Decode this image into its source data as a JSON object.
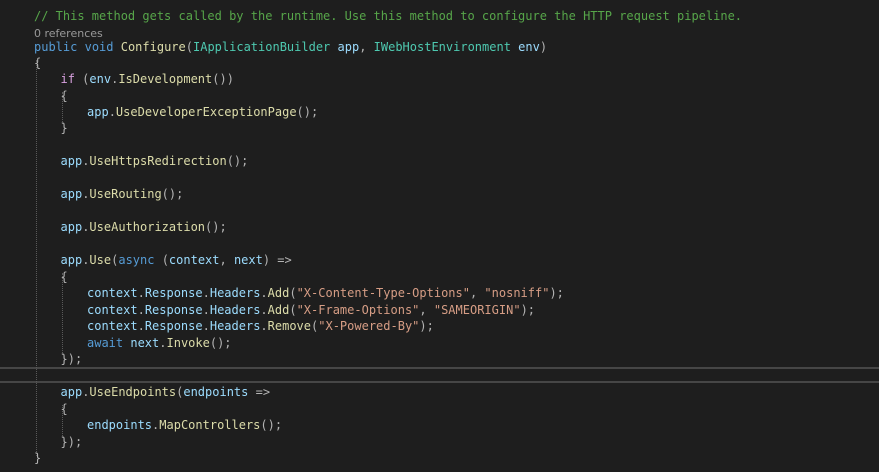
{
  "editor": {
    "codelens": "0 references",
    "lines": [
      [
        {
          "t": "com",
          "v": "// This method gets called by the runtime. Use this method to configure the HTTP request pipeline."
        }
      ],
      [],
      [
        {
          "t": "kw",
          "v": "public"
        },
        {
          "t": "pun",
          "v": " "
        },
        {
          "t": "kw",
          "v": "void"
        },
        {
          "t": "pun",
          "v": " "
        },
        {
          "t": "meth",
          "v": "Configure"
        },
        {
          "t": "pun",
          "v": "("
        },
        {
          "t": "type",
          "v": "IApplicationBuilder"
        },
        {
          "t": "pun",
          "v": " "
        },
        {
          "t": "id",
          "v": "app"
        },
        {
          "t": "pun",
          "v": ", "
        },
        {
          "t": "type",
          "v": "IWebHostEnvironment"
        },
        {
          "t": "pun",
          "v": " "
        },
        {
          "t": "id",
          "v": "env"
        },
        {
          "t": "pun",
          "v": ")"
        }
      ],
      [
        {
          "t": "pun",
          "v": "{"
        }
      ],
      [
        {
          "t": "ctl",
          "v": "if"
        },
        {
          "t": "pun",
          "v": " ("
        },
        {
          "t": "id",
          "v": "env"
        },
        {
          "t": "pun",
          "v": "."
        },
        {
          "t": "meth",
          "v": "IsDevelopment"
        },
        {
          "t": "pun",
          "v": "())"
        }
      ],
      [
        {
          "t": "pun",
          "v": "{"
        }
      ],
      [
        {
          "t": "id",
          "v": "app"
        },
        {
          "t": "pun",
          "v": "."
        },
        {
          "t": "meth",
          "v": "UseDeveloperExceptionPage"
        },
        {
          "t": "pun",
          "v": "();"
        }
      ],
      [
        {
          "t": "pun",
          "v": "}"
        }
      ],
      [],
      [
        {
          "t": "id",
          "v": "app"
        },
        {
          "t": "pun",
          "v": "."
        },
        {
          "t": "meth",
          "v": "UseHttpsRedirection"
        },
        {
          "t": "pun",
          "v": "();"
        }
      ],
      [],
      [
        {
          "t": "id",
          "v": "app"
        },
        {
          "t": "pun",
          "v": "."
        },
        {
          "t": "meth",
          "v": "UseRouting"
        },
        {
          "t": "pun",
          "v": "();"
        }
      ],
      [],
      [
        {
          "t": "id",
          "v": "app"
        },
        {
          "t": "pun",
          "v": "."
        },
        {
          "t": "meth",
          "v": "UseAuthorization"
        },
        {
          "t": "pun",
          "v": "();"
        }
      ],
      [],
      [
        {
          "t": "id",
          "v": "app"
        },
        {
          "t": "pun",
          "v": "."
        },
        {
          "t": "meth",
          "v": "Use"
        },
        {
          "t": "pun",
          "v": "("
        },
        {
          "t": "kw",
          "v": "async"
        },
        {
          "t": "pun",
          "v": " ("
        },
        {
          "t": "id",
          "v": "context"
        },
        {
          "t": "pun",
          "v": ", "
        },
        {
          "t": "id",
          "v": "next"
        },
        {
          "t": "pun",
          "v": ") =>"
        }
      ],
      [
        {
          "t": "pun",
          "v": "{"
        }
      ],
      [
        {
          "t": "id",
          "v": "context"
        },
        {
          "t": "pun",
          "v": "."
        },
        {
          "t": "id",
          "v": "Response"
        },
        {
          "t": "pun",
          "v": "."
        },
        {
          "t": "id",
          "v": "Headers"
        },
        {
          "t": "pun",
          "v": "."
        },
        {
          "t": "meth",
          "v": "Add"
        },
        {
          "t": "pun",
          "v": "("
        },
        {
          "t": "str",
          "v": "\"X-Content-Type-Options\""
        },
        {
          "t": "pun",
          "v": ", "
        },
        {
          "t": "str",
          "v": "\"nosniff\""
        },
        {
          "t": "pun",
          "v": ");"
        }
      ],
      [
        {
          "t": "id",
          "v": "context"
        },
        {
          "t": "pun",
          "v": "."
        },
        {
          "t": "id",
          "v": "Response"
        },
        {
          "t": "pun",
          "v": "."
        },
        {
          "t": "id",
          "v": "Headers"
        },
        {
          "t": "pun",
          "v": "."
        },
        {
          "t": "meth",
          "v": "Add"
        },
        {
          "t": "pun",
          "v": "("
        },
        {
          "t": "str",
          "v": "\"X-Frame-Options\""
        },
        {
          "t": "pun",
          "v": ", "
        },
        {
          "t": "str",
          "v": "\"SAMEORIGIN\""
        },
        {
          "t": "pun",
          "v": ");"
        }
      ],
      [
        {
          "t": "id",
          "v": "context"
        },
        {
          "t": "pun",
          "v": "."
        },
        {
          "t": "id",
          "v": "Response"
        },
        {
          "t": "pun",
          "v": "."
        },
        {
          "t": "id",
          "v": "Headers"
        },
        {
          "t": "pun",
          "v": "."
        },
        {
          "t": "meth",
          "v": "Remove"
        },
        {
          "t": "pun",
          "v": "("
        },
        {
          "t": "str",
          "v": "\"X-Powered-By\""
        },
        {
          "t": "pun",
          "v": ");"
        }
      ],
      [
        {
          "t": "kw",
          "v": "await"
        },
        {
          "t": "pun",
          "v": " "
        },
        {
          "t": "id",
          "v": "next"
        },
        {
          "t": "pun",
          "v": "."
        },
        {
          "t": "meth",
          "v": "Invoke"
        },
        {
          "t": "pun",
          "v": "();"
        }
      ],
      [
        {
          "t": "pun",
          "v": "});"
        }
      ],
      [],
      [
        {
          "t": "id",
          "v": "app"
        },
        {
          "t": "pun",
          "v": "."
        },
        {
          "t": "meth",
          "v": "UseEndpoints"
        },
        {
          "t": "pun",
          "v": "("
        },
        {
          "t": "id",
          "v": "endpoints"
        },
        {
          "t": "pun",
          "v": " =>"
        }
      ],
      [
        {
          "t": "pun",
          "v": "{"
        }
      ],
      [
        {
          "t": "id",
          "v": "endpoints"
        },
        {
          "t": "pun",
          "v": "."
        },
        {
          "t": "meth",
          "v": "MapControllers"
        },
        {
          "t": "pun",
          "v": "();"
        }
      ],
      [
        {
          "t": "pun",
          "v": "});"
        }
      ],
      [
        {
          "t": "pun",
          "v": "}"
        }
      ]
    ],
    "colors": {
      "background": "#1e1e1e",
      "keyword": "#569cd6",
      "comment": "#57a64a",
      "string": "#d69d85",
      "type": "#4ec9b0",
      "method": "#dcdcaa",
      "identifier": "#9cdcfe",
      "punctuation": "#b4b4b4",
      "control": "#d8a0df"
    }
  }
}
